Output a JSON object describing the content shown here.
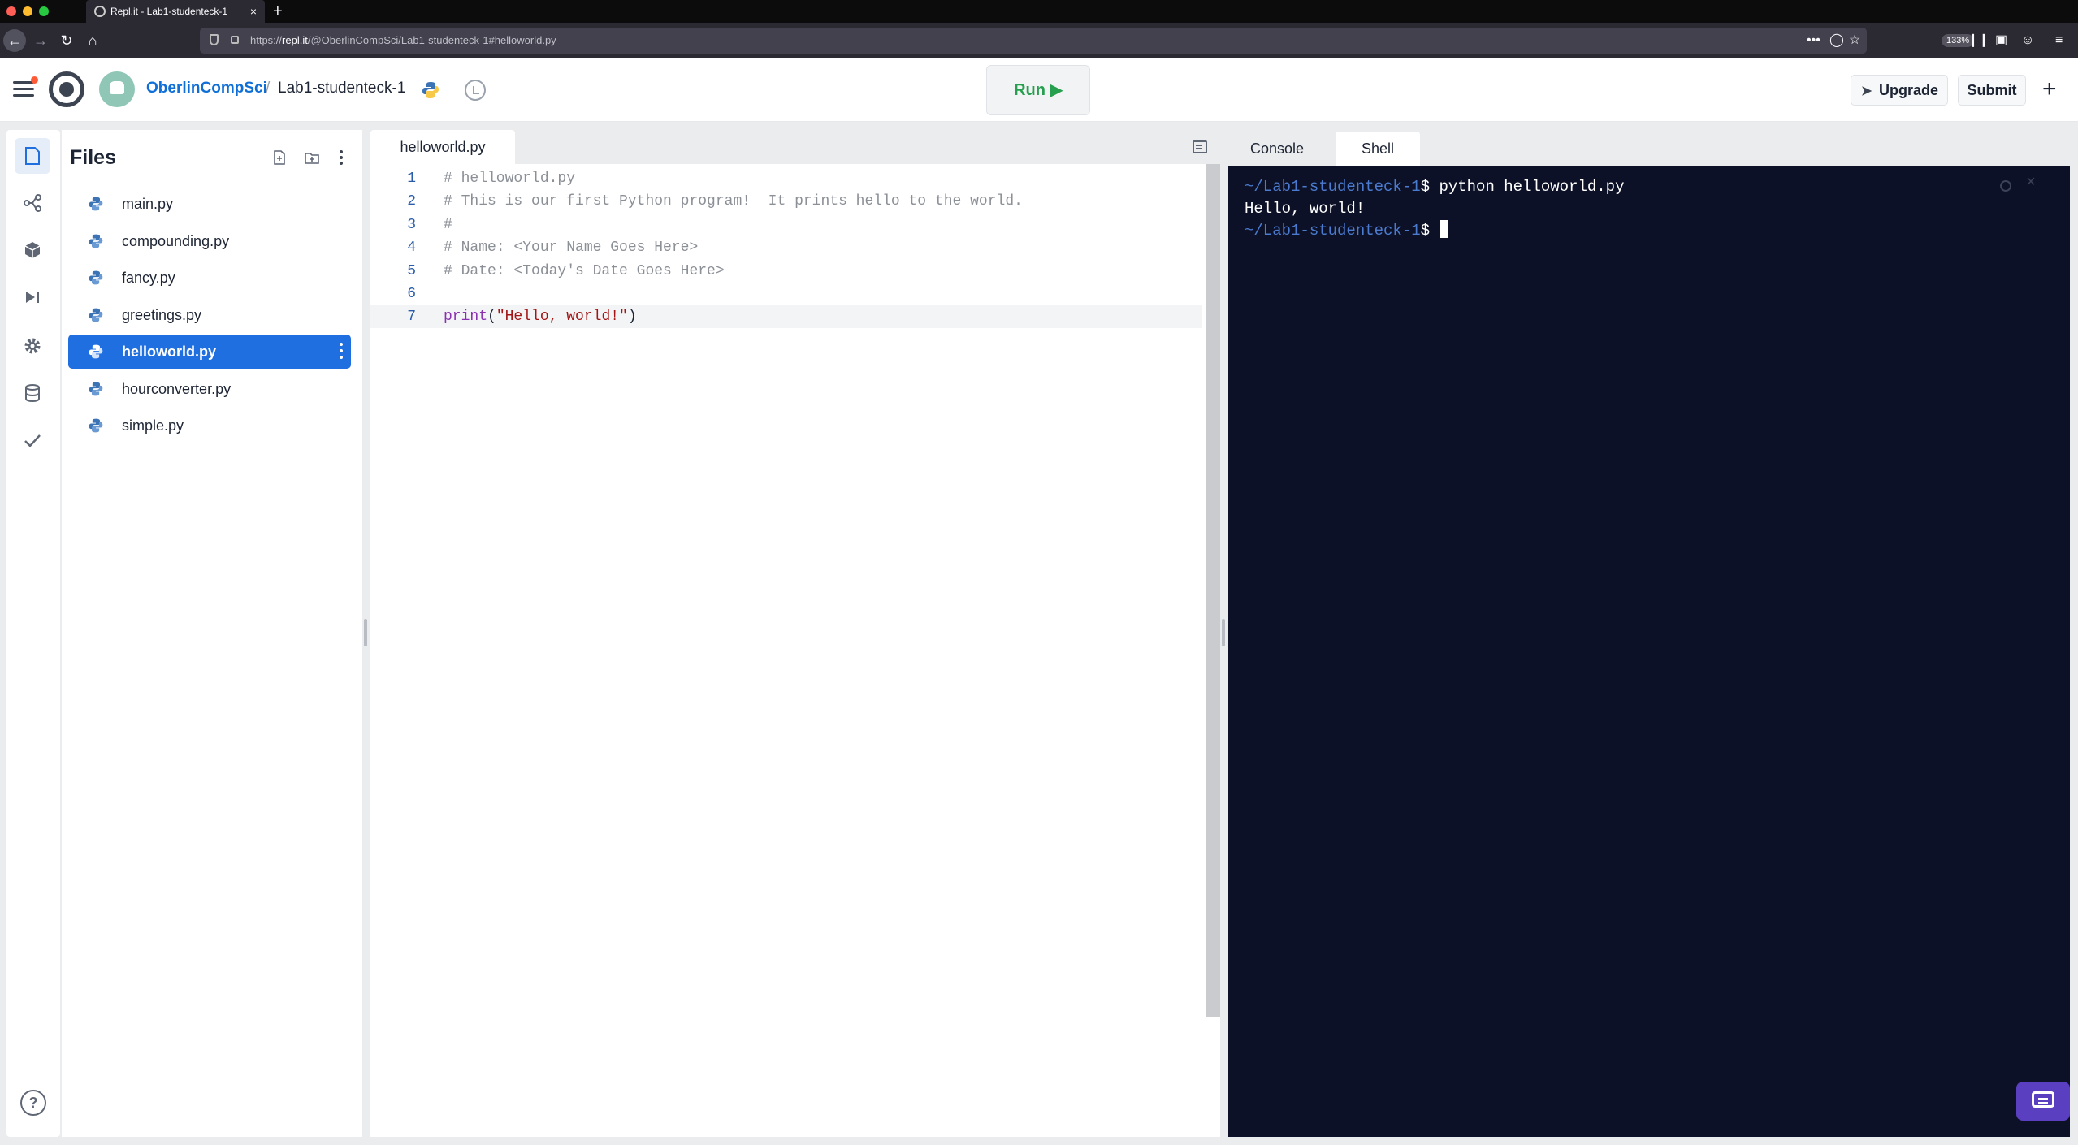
{
  "browser": {
    "tab_title": "Repl.it - Lab1-studenteck-1",
    "tab_close": "×",
    "new_tab": "+",
    "url_prefix": "https://",
    "url_domain": "repl.it",
    "url_path": "/@OberlinCompSci/Lab1-studenteck-1#helloworld.py",
    "zoom": "133%",
    "more": "•••",
    "back": "←",
    "forward": "→",
    "reload": "↻",
    "home": "⌂"
  },
  "header": {
    "owner": "OberlinCompSci",
    "separator": "/",
    "repl_name": "Lab1-studenteck-1",
    "run_label": "Run ▶",
    "upgrade_label": "Upgrade",
    "submit_label": "Submit",
    "add_label": "+"
  },
  "rail": {
    "help_label": "?"
  },
  "files": {
    "title": "Files",
    "items": [
      {
        "name": "main.py"
      },
      {
        "name": "compounding.py"
      },
      {
        "name": "fancy.py"
      },
      {
        "name": "greetings.py"
      },
      {
        "name": "helloworld.py",
        "active": true
      },
      {
        "name": "hourconverter.py"
      },
      {
        "name": "simple.py"
      }
    ]
  },
  "editor": {
    "tab_label": "helloworld.py",
    "lines": [
      {
        "n": "1",
        "text": "# helloworld.py"
      },
      {
        "n": "2",
        "text": "# This is our first Python program!  It prints hello to the world."
      },
      {
        "n": "3",
        "text": "#"
      },
      {
        "n": "4",
        "text": "# Name: <Your Name Goes Here>"
      },
      {
        "n": "5",
        "text": "# Date: <Today's Date Goes Here>"
      },
      {
        "n": "6",
        "text": ""
      },
      {
        "n": "7",
        "fn": "print",
        "open": "(",
        "str": "\"Hello, world!\"",
        "close": ")"
      }
    ]
  },
  "right_pane": {
    "tabs": [
      {
        "label": "Console"
      },
      {
        "label": "Shell",
        "active": true
      }
    ],
    "shell": {
      "prompt": "~/Lab1-studenteck-1",
      "dollar": "$ ",
      "command": "python helloworld.py",
      "output": "Hello, world!"
    },
    "close": "×"
  },
  "colors": {
    "accent_blue": "#1f6fe0",
    "run_green": "#26a04e",
    "shell_bg": "#0d1127",
    "prompt_blue": "#4a7bcf",
    "chat_purple": "#5a3fc0"
  }
}
